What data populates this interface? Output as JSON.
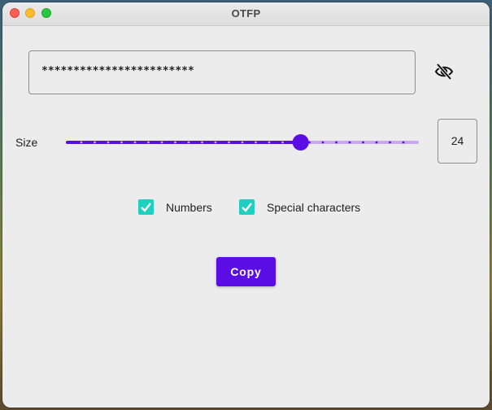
{
  "window": {
    "title": "OTFP"
  },
  "password": {
    "masked_value": "************************",
    "visibility_icon": "eye-off-icon"
  },
  "size": {
    "label": "Size",
    "value": "24",
    "slider_min": 0,
    "slider_max": 36,
    "slider_value": 24,
    "step_marks": 24
  },
  "options": {
    "numbers_label": "Numbers",
    "numbers_checked": true,
    "special_label": "Special characters",
    "special_checked": true
  },
  "actions": {
    "copy_label": "Copy"
  },
  "colors": {
    "accent": "#5a0de4",
    "checkbox": "#1fcfbf",
    "window_bg": "#ececec"
  }
}
